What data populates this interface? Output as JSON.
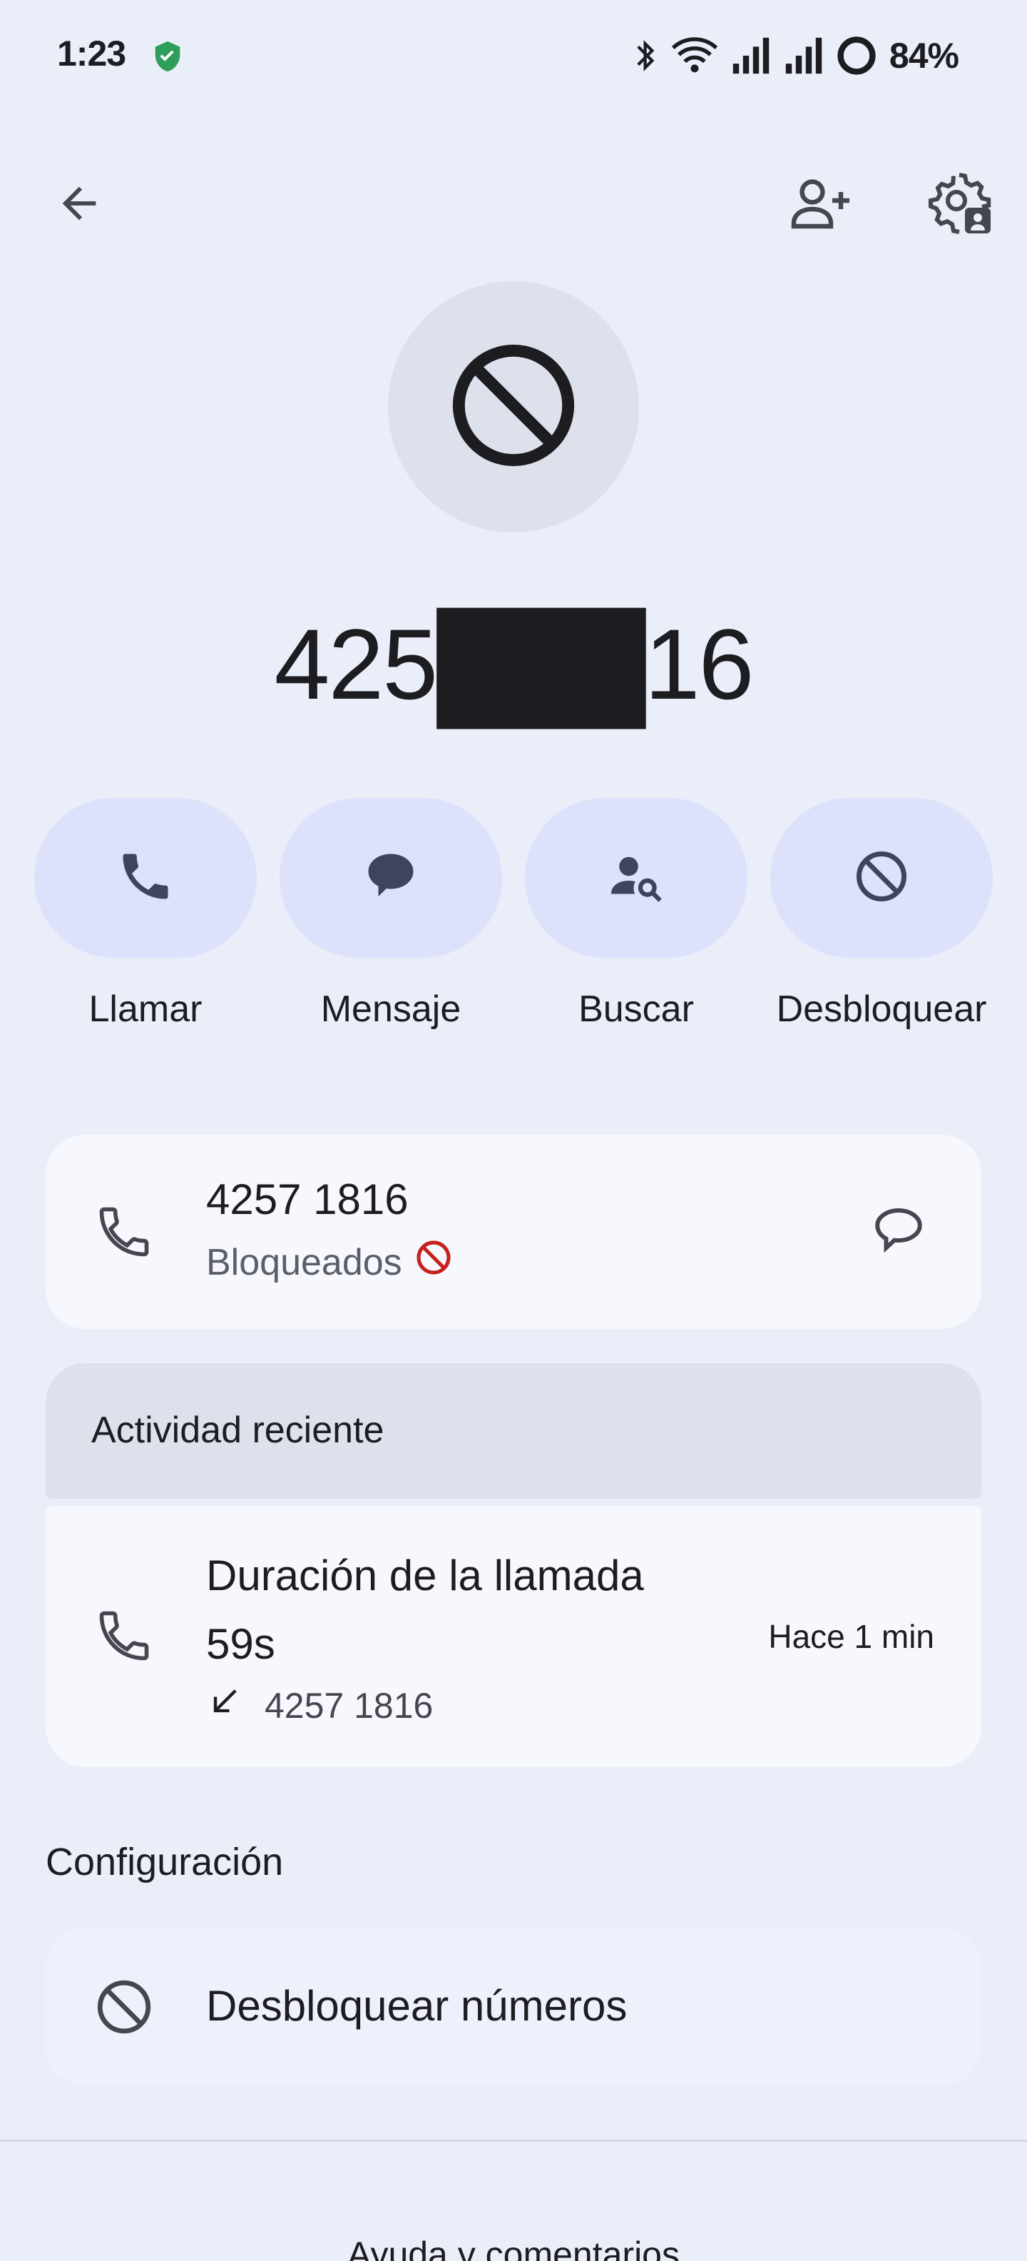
{
  "status_bar": {
    "time": "1:23",
    "battery_percent": "84%"
  },
  "header": {
    "back_icon": "arrow-back-icon",
    "add_contact_icon": "person-add-icon",
    "settings_icon": "settings-account-icon"
  },
  "contact": {
    "avatar_icon": "block-icon",
    "number": "425███16"
  },
  "actions": [
    {
      "label": "Llamar",
      "icon": "phone-icon"
    },
    {
      "label": "Mensaje",
      "icon": "message-icon"
    },
    {
      "label": "Buscar",
      "icon": "person-search-icon"
    },
    {
      "label": "Desbloquear",
      "icon": "block-icon"
    }
  ],
  "number_card": {
    "number": "4257 1816",
    "status": "Bloqueados",
    "message_icon": "message-outline-icon"
  },
  "recent_activity": {
    "header": "Actividad reciente",
    "title": "Duración de la llamada 59s",
    "number": "4257 1816",
    "time": "Hace 1 min",
    "direction_icon": "incoming-arrow-icon"
  },
  "settings": {
    "section_title": "Configuración",
    "unblock_label": "Desbloquear números"
  },
  "footer": {
    "help_label": "Ayuda y comentarios"
  },
  "colors": {
    "background": "#eaeef8",
    "action_pill": "#dde1fb",
    "card": "#f7f8fe",
    "blocked_red": "#c5221f"
  }
}
